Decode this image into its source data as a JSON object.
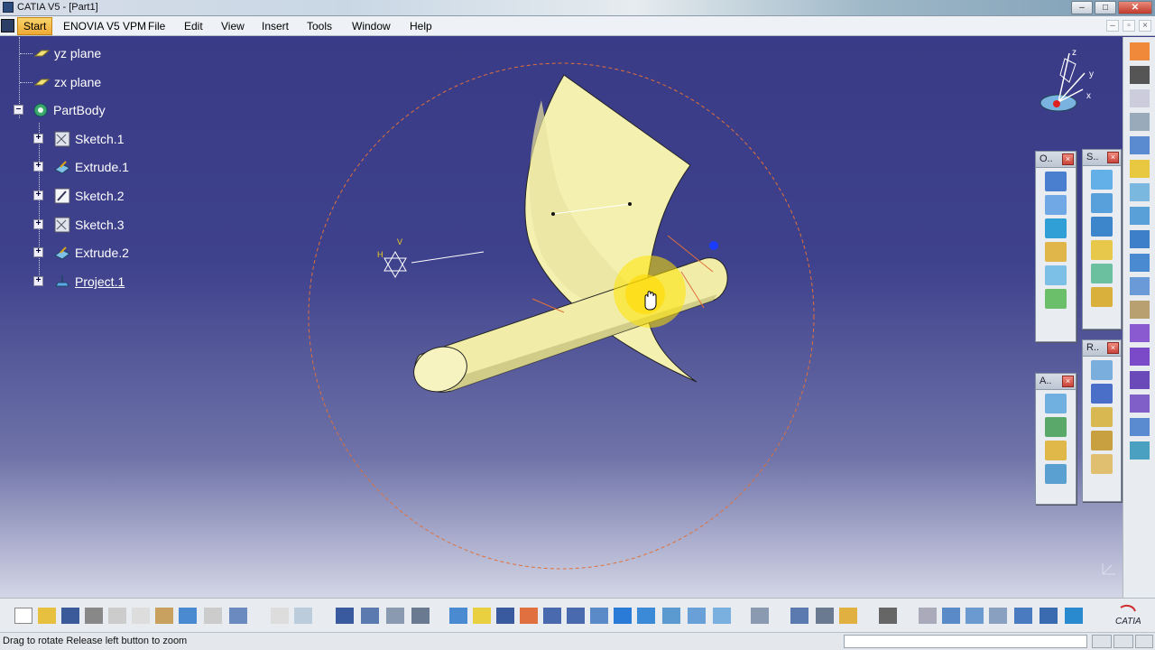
{
  "window": {
    "title": "CATIA V5 - [Part1]",
    "controls": [
      "–",
      "□",
      "✕"
    ]
  },
  "menu": {
    "items": [
      "Start",
      "ENOVIA V5 VPM",
      "File",
      "Edit",
      "View",
      "Insert",
      "Tools",
      "Window",
      "Help"
    ],
    "doc_controls": [
      "–",
      "▫",
      "×"
    ]
  },
  "tree": {
    "nodes": [
      {
        "label": "yz plane",
        "icon": "plane-icon"
      },
      {
        "label": "zx plane",
        "icon": "plane-icon"
      },
      {
        "label": "PartBody",
        "icon": "part-body-icon"
      },
      {
        "label": "Sketch.1",
        "icon": "sketch-icon"
      },
      {
        "label": "Extrude.1",
        "icon": "extrude-icon"
      },
      {
        "label": "Sketch.2",
        "icon": "sketch-icon"
      },
      {
        "label": "Sketch.3",
        "icon": "sketch-icon"
      },
      {
        "label": "Extrude.2",
        "icon": "extrude-icon"
      },
      {
        "label": "Project.1",
        "icon": "project-icon"
      }
    ]
  },
  "compass": {
    "axes": [
      "z",
      "y",
      "x"
    ]
  },
  "sketch_axis": {
    "h_label": "H",
    "v_label": "V"
  },
  "floating_toolbars": [
    {
      "title": "O..",
      "tool_count": 6
    },
    {
      "title": "S..",
      "tool_count": 6
    },
    {
      "title": "R..",
      "tool_count": 5
    },
    {
      "title": "A..",
      "tool_count": 4
    }
  ],
  "colors": {
    "surface": "#f4f0b0",
    "surface_shade": "#d9d48a",
    "rotation_circle": "#e0703a",
    "highlight": "#ffe400",
    "start_menu": "#f0a935"
  },
  "status": {
    "message": "Drag to rotate  Release left button to zoom"
  },
  "watermark": "CATIA"
}
